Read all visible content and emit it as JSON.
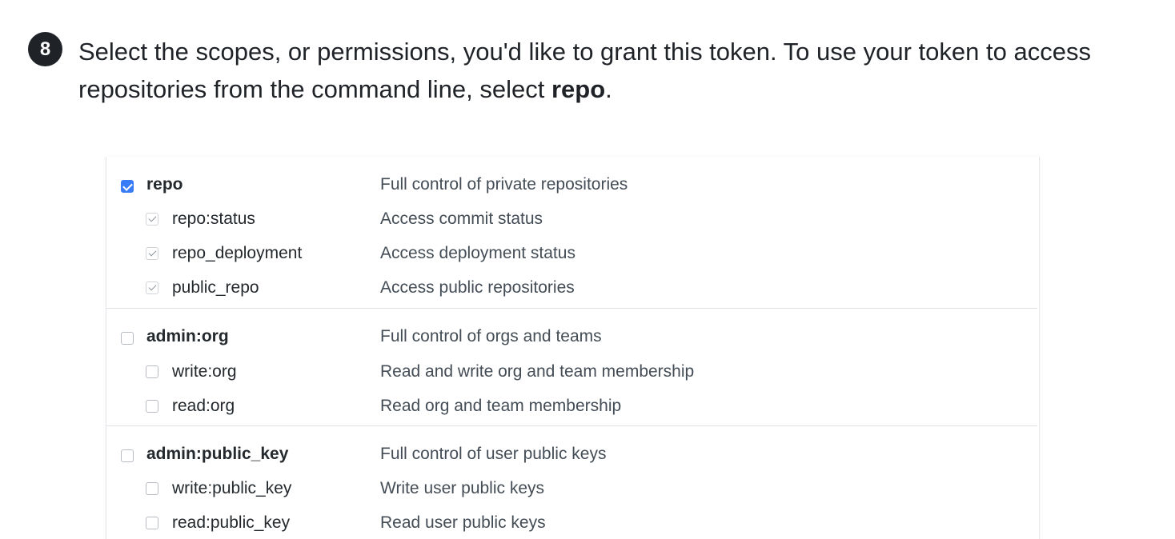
{
  "step": {
    "number": "8",
    "text_before": "Select the scopes, or permissions, you'd like to grant this token. To use your token to access repositories from the command line, select ",
    "bold_word": "repo",
    "text_after": "."
  },
  "scope_groups": [
    {
      "parent": {
        "name": "repo",
        "description": "Full control of private repositories",
        "checked": true
      },
      "children": [
        {
          "name": "repo:status",
          "description": "Access commit status",
          "checked": true
        },
        {
          "name": "repo_deployment",
          "description": "Access deployment status",
          "checked": true
        },
        {
          "name": "public_repo",
          "description": "Access public repositories",
          "checked": true
        }
      ]
    },
    {
      "parent": {
        "name": "admin:org",
        "description": "Full control of orgs and teams",
        "checked": false
      },
      "children": [
        {
          "name": "write:org",
          "description": "Read and write org and team membership",
          "checked": false
        },
        {
          "name": "read:org",
          "description": "Read org and team membership",
          "checked": false
        }
      ]
    },
    {
      "parent": {
        "name": "admin:public_key",
        "description": "Full control of user public keys",
        "checked": false
      },
      "children": [
        {
          "name": "write:public_key",
          "description": "Write user public keys",
          "checked": false
        },
        {
          "name": "read:public_key",
          "description": "Read user public keys",
          "checked": false
        }
      ]
    }
  ],
  "colors": {
    "checkbox_checked": "#3a7cf7",
    "badge": "#1f2328"
  }
}
